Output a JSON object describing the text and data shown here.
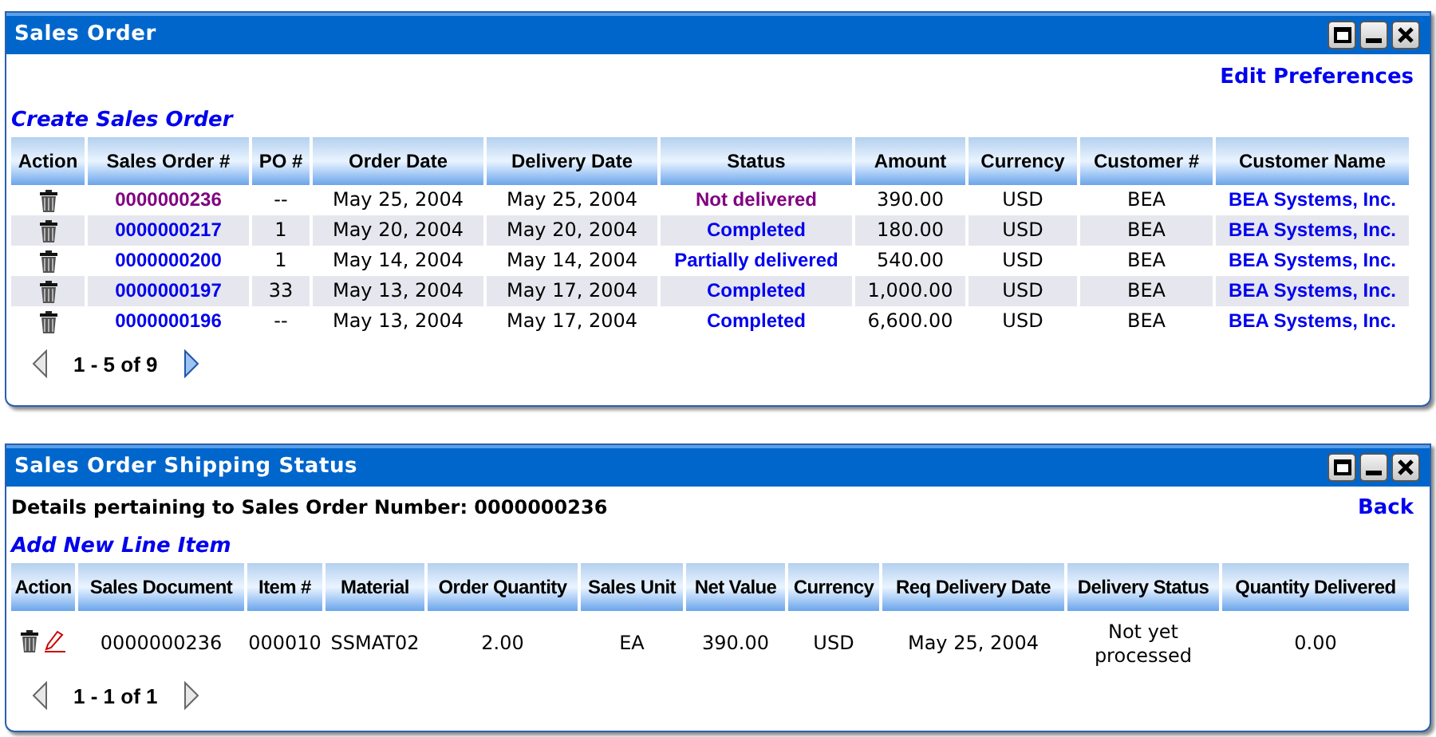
{
  "orders_panel": {
    "title": "Sales Order",
    "edit_link": "Edit Preferences",
    "create_link": "Create Sales Order",
    "columns": [
      "Action",
      "Sales Order #",
      "PO #",
      "Order Date",
      "Delivery Date",
      "Status",
      "Amount",
      "Currency",
      "Customer #",
      "Customer Name"
    ],
    "rows": [
      {
        "selected": true,
        "order": "0000000236",
        "po": "--",
        "order_date": "May 25, 2004",
        "delivery_date": "May 25, 2004",
        "status": "Not delivered",
        "amount": "390.00",
        "currency": "USD",
        "customer_no": "BEA",
        "customer_name": "BEA Systems, Inc."
      },
      {
        "selected": false,
        "order": "0000000217",
        "po": "1",
        "order_date": "May 20, 2004",
        "delivery_date": "May 20, 2004",
        "status": "Completed",
        "amount": "180.00",
        "currency": "USD",
        "customer_no": "BEA",
        "customer_name": "BEA Systems, Inc."
      },
      {
        "selected": false,
        "order": "0000000200",
        "po": "1",
        "order_date": "May 14, 2004",
        "delivery_date": "May 14, 2004",
        "status": "Partially delivered",
        "amount": "540.00",
        "currency": "USD",
        "customer_no": "BEA",
        "customer_name": "BEA Systems, Inc."
      },
      {
        "selected": false,
        "order": "0000000197",
        "po": "33",
        "order_date": "May 13, 2004",
        "delivery_date": "May 17, 2004",
        "status": "Completed",
        "amount": "1,000.00",
        "currency": "USD",
        "customer_no": "BEA",
        "customer_name": "BEA Systems, Inc."
      },
      {
        "selected": false,
        "order": "0000000196",
        "po": "--",
        "order_date": "May 13, 2004",
        "delivery_date": "May 17, 2004",
        "status": "Completed",
        "amount": "6,600.00",
        "currency": "USD",
        "customer_no": "BEA",
        "customer_name": "BEA Systems, Inc."
      }
    ],
    "pager": {
      "text": "1 - 5 of 9",
      "prev_disabled": true,
      "next_disabled": false
    }
  },
  "shipping_panel": {
    "title": "Sales Order Shipping Status",
    "details": "Details pertaining to Sales Order Number: 0000000236",
    "back_link": "Back",
    "add_link": "Add New Line Item",
    "columns": [
      "Action",
      "Sales Document",
      "Item #",
      "Material",
      "Order Quantity",
      "Sales Unit",
      "Net Value",
      "Currency",
      "Req Delivery Date",
      "Delivery Status",
      "Quantity Delivered"
    ],
    "rows": [
      {
        "cells": [
          "",
          "0000000236",
          "000010",
          "SSMAT02",
          "2.00",
          "EA",
          "390.00",
          "USD",
          "May 25, 2004",
          "Not yet processed",
          "0.00"
        ]
      }
    ],
    "pager": {
      "text": "1 - 1 of 1",
      "prev_disabled": true,
      "next_disabled": true
    }
  }
}
